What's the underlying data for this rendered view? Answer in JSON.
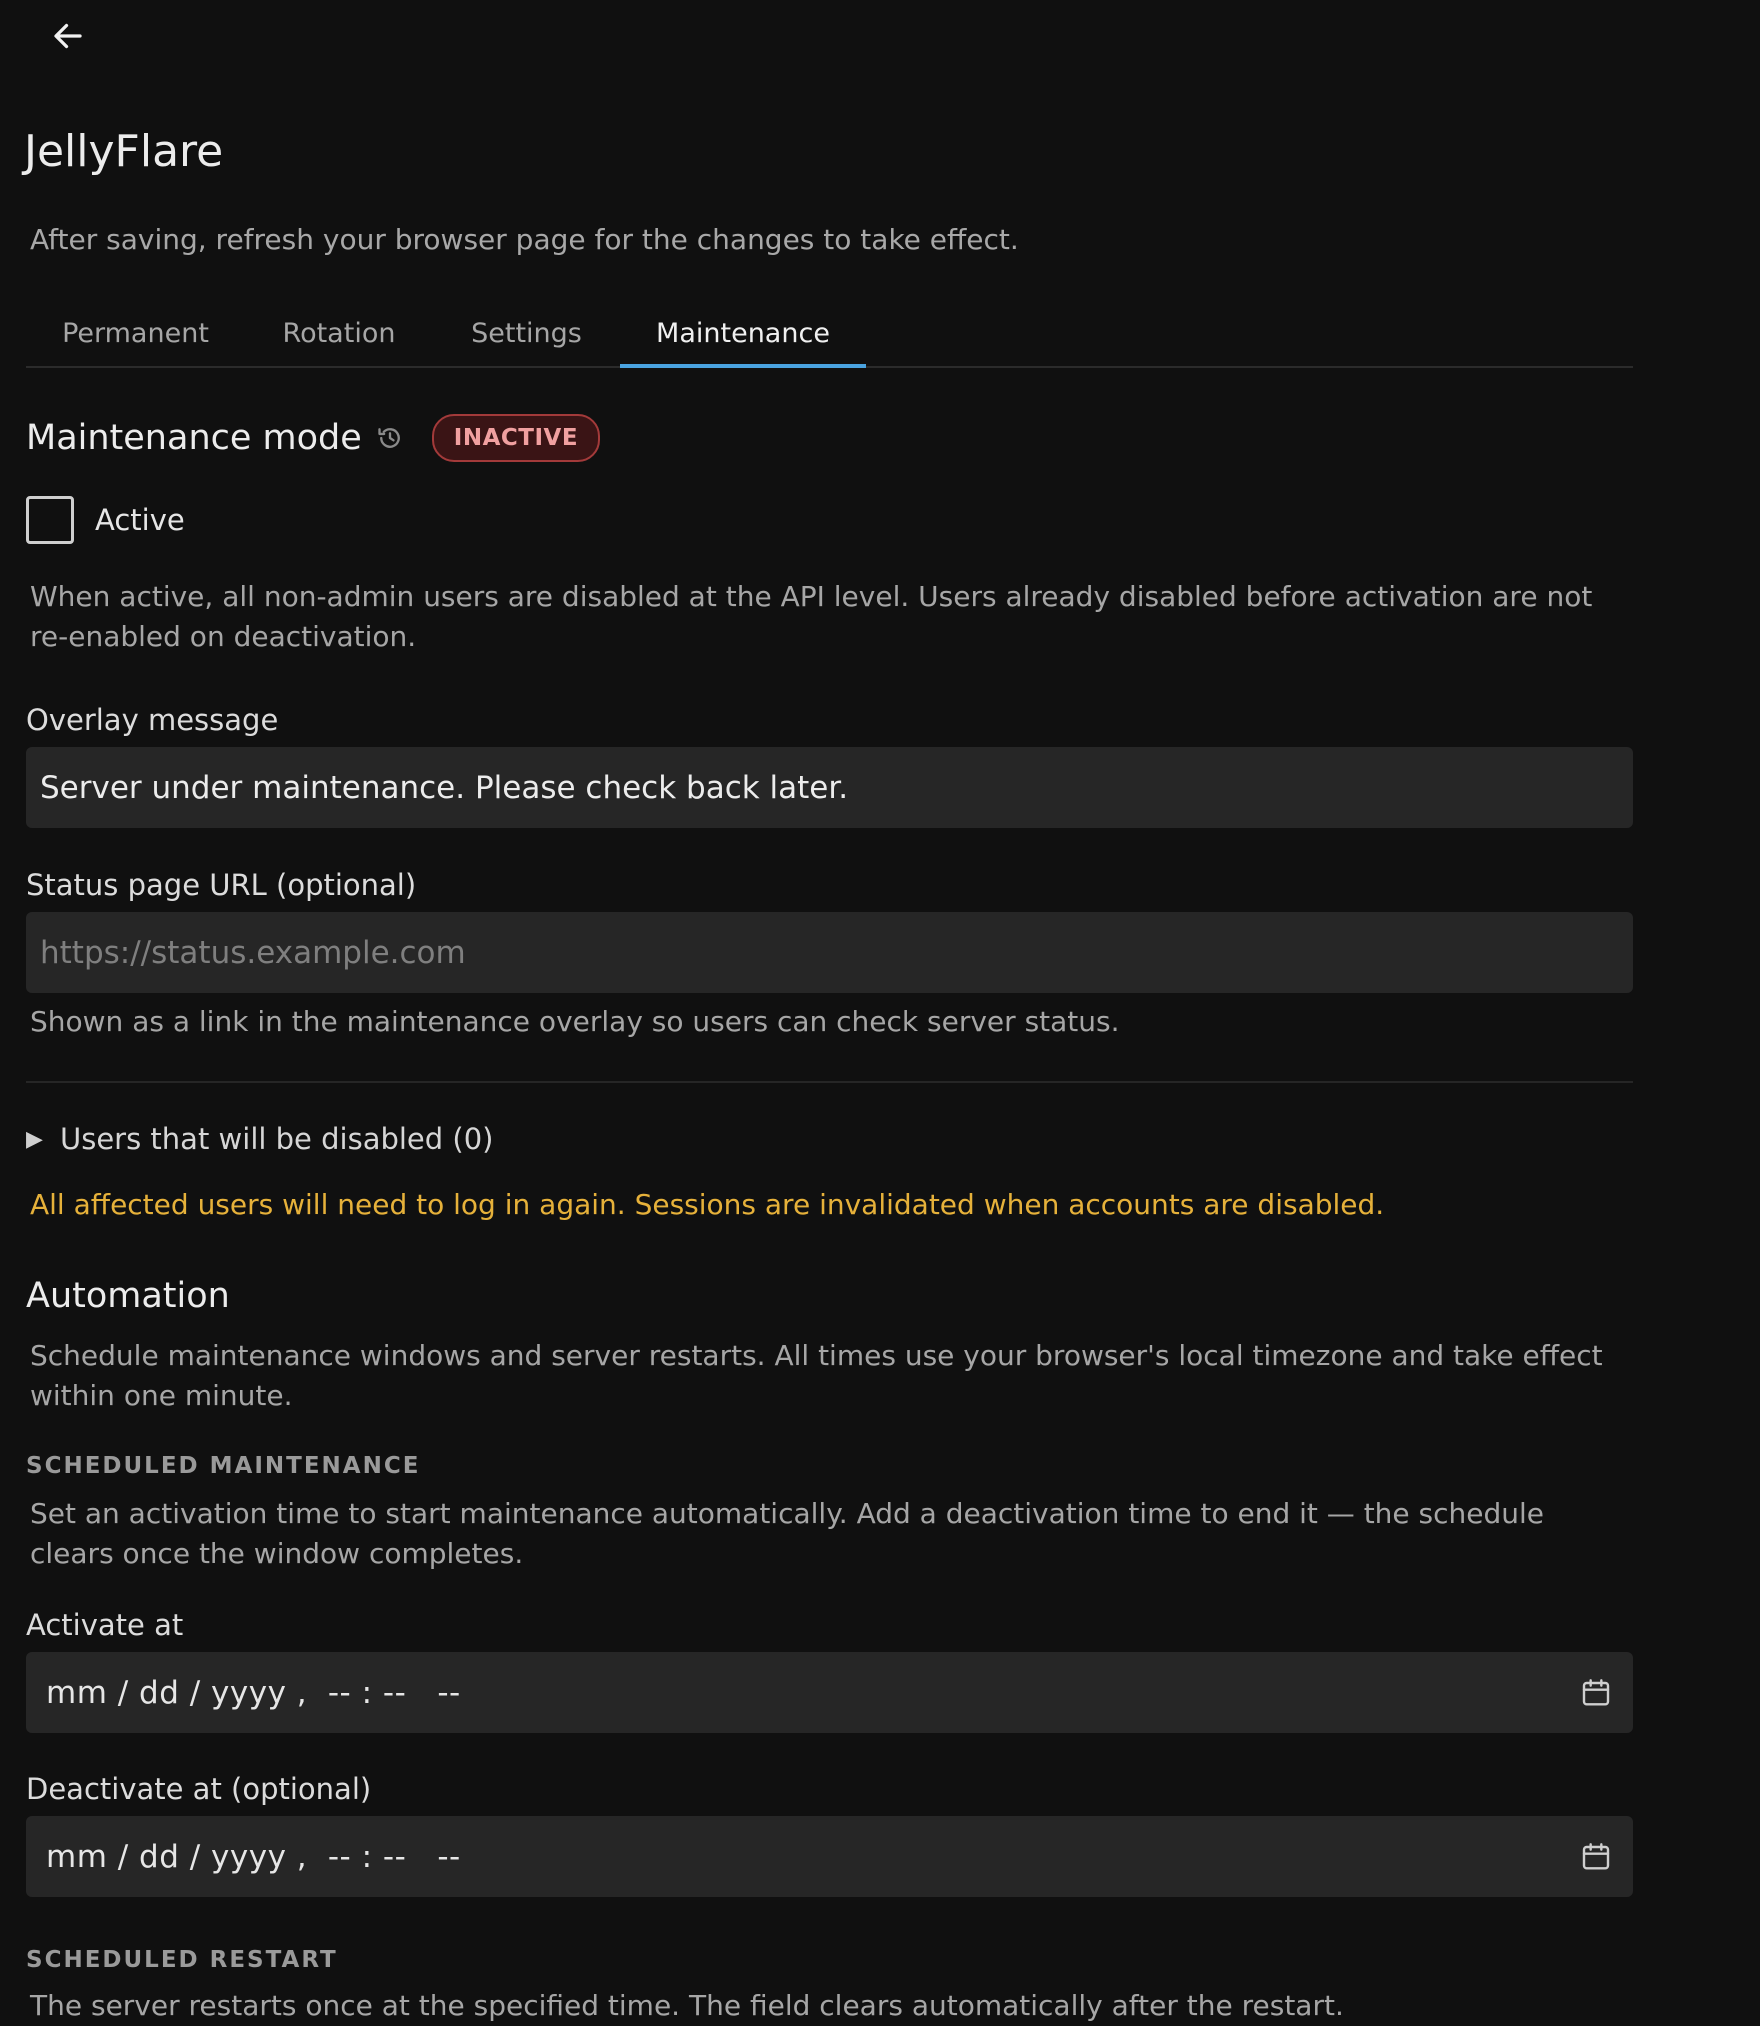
{
  "app": {
    "title": "JellyFlare",
    "subtitle": "After saving, refresh your browser page for the changes to take effect."
  },
  "tabs": [
    {
      "label": "Permanent",
      "active": false
    },
    {
      "label": "Rotation",
      "active": false
    },
    {
      "label": "Settings",
      "active": false
    },
    {
      "label": "Maintenance",
      "active": true
    }
  ],
  "maintenance": {
    "title": "Maintenance mode",
    "status_badge": "INACTIVE",
    "active_checkbox_label": "Active",
    "active_checked": false,
    "active_help": "When active, all non-admin users are disabled at the API level. Users already disabled before activation are not re-enabled on deactivation.",
    "overlay_label": "Overlay message",
    "overlay_value": "Server under maintenance. Please check back later.",
    "status_url_label": "Status page URL (optional)",
    "status_url_placeholder": "https://status.example.com",
    "status_url_value": "",
    "status_url_help": "Shown as a link in the maintenance overlay so users can check server status.",
    "users_disclosure": "Users that will be disabled (0)",
    "warning": "All affected users will need to log in again. Sessions are invalidated when accounts are disabled."
  },
  "automation": {
    "title": "Automation",
    "description": "Schedule maintenance windows and server restarts. All times use your browser's local timezone and take effect within one minute.",
    "scheduled_maintenance": {
      "heading": "SCHEDULED MAINTENANCE",
      "description": "Set an activation time to start maintenance automatically. Add a deactivation time to end it — the schedule clears once the window completes.",
      "activate_label": "Activate at",
      "activate_value": "mm / dd / yyyy ,  -- : --   --",
      "deactivate_label": "Deactivate at (optional)",
      "deactivate_value": "mm / dd / yyyy ,  -- : --   --"
    },
    "scheduled_restart": {
      "heading": "SCHEDULED RESTART",
      "description": "The server restarts once at the specified time. The field clears automatically after the restart."
    }
  },
  "colors": {
    "background": "#101010",
    "input_bg": "#262626",
    "accent": "#4aa3e0",
    "warning": "#e6b13a",
    "badge_border": "#a33a3a",
    "badge_bg": "#3a1415",
    "badge_text": "#f0a0a0"
  },
  "icons": {
    "back": "arrow-left-icon",
    "history": "history-icon",
    "disclosure": "triangle-right-icon",
    "calendar": "calendar-icon"
  }
}
